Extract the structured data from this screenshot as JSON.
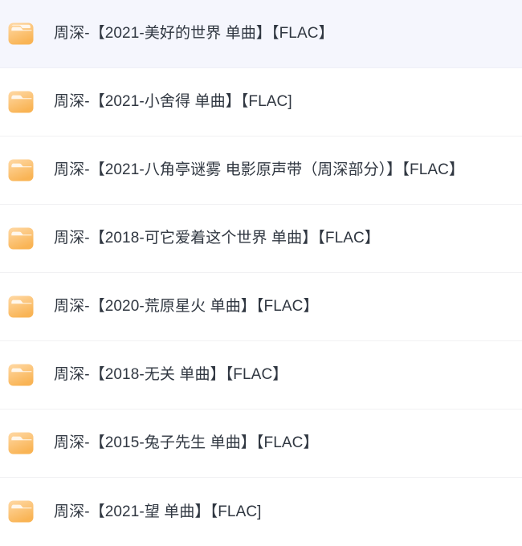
{
  "window": {
    "background_color": "#ffffff",
    "selected_row_color": "#f5f6fd",
    "separator_color": "#f1f1f3",
    "text_color": "#303741",
    "folder_icon_color_light": "#ffd9a6",
    "folder_icon_color_dark": "#f9b455",
    "folder_tab_color": "#fff7ec"
  },
  "file_list": {
    "icon_name": "folder-icon",
    "items": [
      {
        "name": "周深-【2021-美好的世界 单曲】【FLAC】",
        "selected": true
      },
      {
        "name": "周深-【2021-小舍得 单曲】【FLAC]",
        "selected": false
      },
      {
        "name": "周深-【2021-八角亭谜雾 电影原声带（周深部分）】【FLAC】",
        "selected": false
      },
      {
        "name": "周深-【2018-可它爱着这个世界 单曲】【FLAC】",
        "selected": false
      },
      {
        "name": "周深-【2020-荒原星火 单曲】【FLAC】",
        "selected": false
      },
      {
        "name": "周深-【2018-无关 单曲】【FLAC】",
        "selected": false
      },
      {
        "name": "周深-【2015-兔子先生 单曲】【FLAC】",
        "selected": false
      },
      {
        "name": "周深-【2021-望 单曲】【FLAC]",
        "selected": false
      }
    ]
  }
}
